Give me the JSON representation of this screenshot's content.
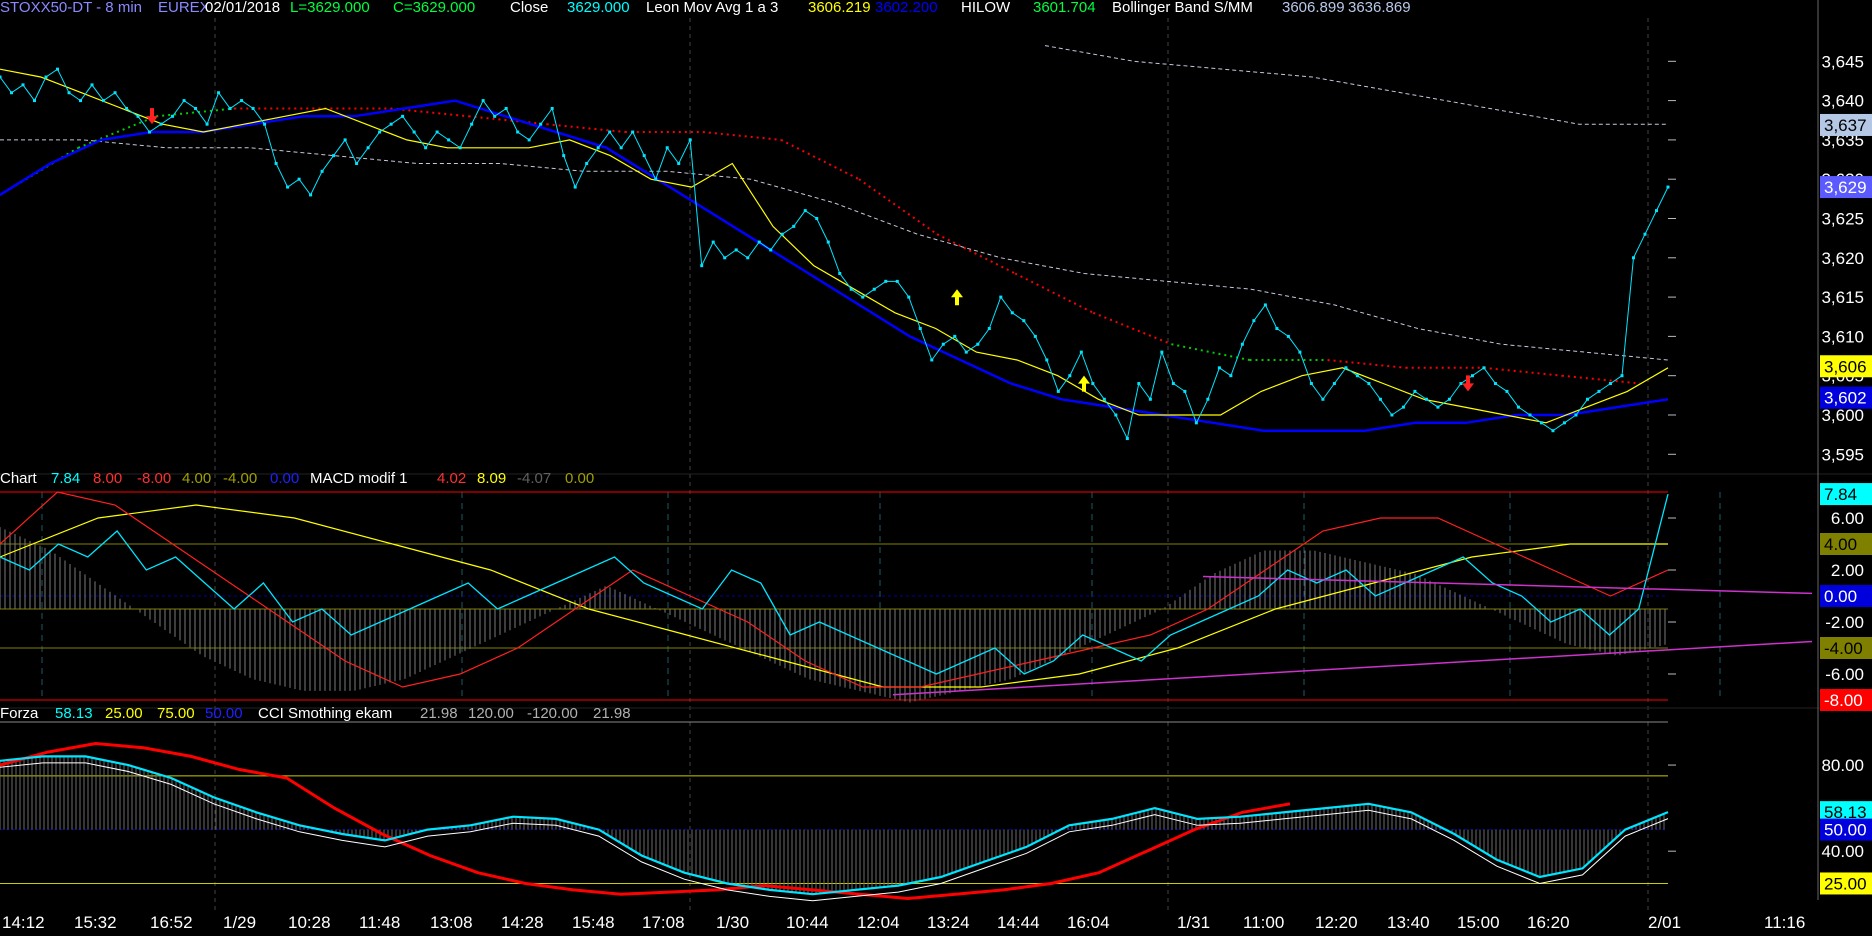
{
  "top_header": {
    "symbol": "STOXX50-DT - 8 min",
    "exchange": "EUREX",
    "date": "02/01/2018",
    "last": "L=3629.000",
    "close_eq": "C=3629.000",
    "close_label": "Close",
    "close_value": "3629.000",
    "leon_label": "Leon Mov Avg 1 a 3",
    "leon_v1": "3606.219",
    "leon_v2": "3602.200",
    "hilow_label": "HILOW",
    "hilow_value": "3601.704",
    "boll_label": "Bollinger Band S/MM",
    "boll_v1": "3606.899",
    "boll_v2": "3636.869"
  },
  "mid_header": {
    "chart_label": "Chart",
    "v1": "7.84",
    "v2": "8.00",
    "v3": "-8.00",
    "v4": "4.00",
    "v5": "-4.00",
    "v6": "0.00",
    "macd_label": "MACD modif 1",
    "m1": "4.02",
    "m2": "8.09",
    "m3": "-4.07",
    "m4": "0.00"
  },
  "low_header": {
    "forza_label": "Forza",
    "f1": "58.13",
    "f2": "25.00",
    "f3": "75.00",
    "f4": "50.00",
    "cci_label": "CCI Smothing ekam",
    "c1": "21.98",
    "c2": "120.00",
    "c3": "-120.00",
    "c4": "21.98"
  },
  "price_axis": {
    "ticks": [
      "3,645",
      "3,640",
      "3,635",
      "3,630",
      "3,625",
      "3,620",
      "3,615",
      "3,610",
      "3,605",
      "3,600",
      "3,595"
    ],
    "tags": [
      {
        "text": "3,637",
        "bg": "#b4c8e6",
        "fg": "#000000",
        "value": 3636.9
      },
      {
        "text": "3,629",
        "bg": "#5a5aff",
        "fg": "#ffffff",
        "value": 3629.0
      },
      {
        "text": "3,606",
        "bg": "#ffff00",
        "fg": "#000000",
        "value": 3606.2
      },
      {
        "text": "3,602",
        "bg": "#0000dd",
        "fg": "#ffffff",
        "value": 3602.2
      }
    ]
  },
  "macd_axis": {
    "ticks": [
      "6.00",
      "2.00",
      "-2.00",
      "-6.00"
    ],
    "tags": [
      {
        "text": "7.84",
        "bg": "#00ffff",
        "fg": "#000000",
        "value": 7.84
      },
      {
        "text": "4.00",
        "bg": "#808000",
        "fg": "#000000",
        "value": 4.0
      },
      {
        "text": "0.00",
        "bg": "#0000dd",
        "fg": "#ffffff",
        "value": 0.0
      },
      {
        "text": "-4.00",
        "bg": "#808000",
        "fg": "#000000",
        "value": -4.0
      },
      {
        "text": "-8.00",
        "bg": "#ff0000",
        "fg": "#ffffff",
        "value": -8.0
      }
    ]
  },
  "cci_axis": {
    "ticks": [
      "80.00",
      "40.00"
    ],
    "tags": [
      {
        "text": "58.13",
        "bg": "#00ffff",
        "fg": "#000000",
        "value": 58.13
      },
      {
        "text": "50.00",
        "bg": "#0000dd",
        "fg": "#ffffff",
        "value": 50.0
      },
      {
        "text": "25.00",
        "bg": "#ffff00",
        "fg": "#000000",
        "value": 25.0
      }
    ]
  },
  "time_axis": {
    "labels": [
      "14:12",
      "15:32",
      "16:52",
      "1/29",
      "10:28",
      "11:48",
      "13:08",
      "14:28",
      "15:48",
      "17:08",
      "1/30",
      "10:44",
      "12:04",
      "13:24",
      "14:44",
      "16:04",
      "1/31",
      "11:00",
      "12:20",
      "13:40",
      "15:00",
      "16:20",
      "2/01",
      "11:16"
    ]
  },
  "colors": {
    "close": "#00e5ff",
    "leon_fast": "#ffff00",
    "leon_slow": "#0000ff",
    "hilow_up": "#00cc00",
    "hilow_down": "#ff0000",
    "bollinger": "#c8c8dc",
    "macd_signal": "#ff2020",
    "trendline": "#cc33cc",
    "forza": "#ff0000"
  },
  "chart_data": [
    {
      "type": "line",
      "name": "price",
      "ylim": [
        3593,
        3650
      ],
      "series": [
        {
          "name": "Close",
          "values": [
            3643,
            3641,
            3642,
            3640,
            3643,
            3644,
            3641,
            3640,
            3642,
            3640,
            3641,
            3639,
            3638,
            3636,
            3637,
            3638,
            3640,
            3639,
            3637,
            3641,
            3639,
            3640,
            3639,
            3637,
            3632,
            3629,
            3630,
            3628,
            3631,
            3633,
            3635,
            3632,
            3634,
            3636,
            3637,
            3638,
            3636,
            3634,
            3636,
            3635,
            3634,
            3637,
            3640,
            3638,
            3639,
            3636,
            3635,
            3637,
            3639,
            3633,
            3629,
            3632,
            3634,
            3636,
            3634,
            3636,
            3633,
            3630,
            3634,
            3632,
            3635,
            3619,
            3622,
            3620,
            3621,
            3620,
            3622,
            3621,
            3623,
            3624,
            3626,
            3625,
            3622,
            3618,
            3616,
            3615,
            3616,
            3617,
            3617,
            3615,
            3611,
            3607,
            3609,
            3610,
            3608,
            3609,
            3611,
            3615,
            3613,
            3612,
            3610,
            3607,
            3603,
            3605,
            3608,
            3604,
            3602,
            3600,
            3597,
            3604,
            3602,
            3608,
            3604,
            3603,
            3599,
            3602,
            3606,
            3605,
            3609,
            3612,
            3614,
            3611,
            3610,
            3608,
            3604,
            3602,
            3604,
            3606,
            3605,
            3604,
            3602,
            3600,
            3601,
            3603,
            3602,
            3601,
            3602,
            3604,
            3605,
            3606,
            3604,
            3603,
            3601,
            3600,
            3599,
            3598,
            3599,
            3600,
            3602,
            3603,
            3604,
            3605,
            3620,
            3623,
            3626,
            3629
          ]
        },
        {
          "name": "Leon fast",
          "values": [
            3644,
            3643,
            3641,
            3639,
            3637,
            3636,
            3637,
            3638,
            3639,
            3637,
            3635,
            3634,
            3634,
            3634,
            3635,
            3633,
            3630,
            3629,
            3632,
            3624,
            3619,
            3616,
            3613,
            3611,
            3608,
            3607,
            3605,
            3602,
            3600,
            3600,
            3600,
            3603,
            3605,
            3606,
            3604,
            3602,
            3601,
            3600,
            3599,
            3601,
            3603,
            3606
          ]
        },
        {
          "name": "Leon slow",
          "values": [
            3628,
            3632,
            3635,
            3636,
            3636,
            3637,
            3638,
            3638,
            3639,
            3640,
            3638,
            3636,
            3634,
            3630,
            3626,
            3622,
            3618,
            3614,
            3610,
            3607,
            3604,
            3602,
            3601,
            3600,
            3599,
            3598,
            3598,
            3598,
            3599,
            3599,
            3600,
            3600,
            3601,
            3602
          ]
        },
        {
          "name": "HILOW",
          "values": [
            3628,
            3634,
            3638,
            3639,
            3639,
            3639,
            3638,
            3637,
            3636,
            3636,
            3635,
            3630,
            3623,
            3618,
            3613,
            3609,
            3607,
            3607,
            3606,
            3606,
            3605,
            3604
          ]
        },
        {
          "name": "Bollinger",
          "values": [
            3635,
            3635,
            3634,
            3634,
            3633,
            3632,
            3632,
            3631,
            3631,
            3630,
            3627,
            3623,
            3620,
            3618,
            3617,
            3616,
            3614,
            3611,
            3609,
            3608,
            3607,
            3647,
            3645,
            3644,
            3643,
            3641,
            3639,
            3637,
            3637
          ]
        }
      ]
    },
    {
      "type": "line",
      "name": "macd",
      "ylim": [
        -8,
        8
      ],
      "series": [
        {
          "name": "MACD",
          "values": [
            3,
            2,
            4,
            3,
            5,
            2,
            3,
            1,
            -1,
            1,
            -2,
            -1,
            -3,
            -2,
            -1,
            0,
            1,
            -1,
            0,
            1,
            2,
            3,
            1,
            0,
            -1,
            2,
            1,
            -3,
            -2,
            -3,
            -4,
            -5,
            -6,
            -5,
            -4,
            -6,
            -5,
            -3,
            -4,
            -5,
            -3,
            -2,
            -1,
            0,
            2,
            1,
            2,
            0,
            1,
            2,
            3,
            1,
            0,
            -2,
            -1,
            -3,
            -1,
            7.84
          ]
        },
        {
          "name": "Signal",
          "values": [
            4,
            8,
            7,
            4,
            1,
            -2,
            -5,
            -7,
            -6,
            -4,
            -1,
            2,
            0,
            -2,
            -5,
            -7,
            -7,
            -6,
            -5,
            -4,
            -3,
            -1,
            2,
            5,
            6,
            6,
            4,
            2,
            0,
            2
          ]
        },
        {
          "name": "Slow",
          "values": [
            3,
            6,
            7,
            6,
            4,
            2,
            -1,
            -3,
            -5,
            -7,
            -7,
            -6,
            -4,
            -1,
            1,
            3,
            4,
            4
          ]
        },
        {
          "name": "Histogram",
          "values": [
            7,
            5,
            2,
            -1,
            -4,
            -6,
            -7,
            -7,
            -6,
            -4,
            -2,
            0,
            2,
            0,
            -2,
            -4,
            -6,
            -7,
            -8,
            -7,
            -6,
            -4,
            -2,
            0,
            3,
            5,
            5,
            4,
            3,
            1,
            -1,
            -3,
            -4,
            -3
          ]
        }
      ]
    },
    {
      "type": "line",
      "name": "cci",
      "ylim": [
        15,
        100
      ],
      "series": [
        {
          "name": "Forza",
          "values": [
            80,
            86,
            90,
            88,
            84,
            78,
            74,
            60,
            48,
            38,
            30,
            25,
            22,
            20,
            21,
            22,
            24,
            22,
            20,
            18,
            20,
            22,
            25,
            30,
            40,
            50,
            58,
            62
          ]
        },
        {
          "name": "CCI",
          "values": [
            82,
            84,
            84,
            80,
            74,
            65,
            58,
            52,
            48,
            45,
            50,
            52,
            56,
            55,
            50,
            38,
            30,
            25,
            22,
            20,
            22,
            24,
            28,
            35,
            42,
            52,
            55,
            60,
            55,
            56,
            58,
            60,
            62,
            58,
            48,
            36,
            28,
            32,
            50,
            58.13
          ]
        }
      ]
    }
  ]
}
